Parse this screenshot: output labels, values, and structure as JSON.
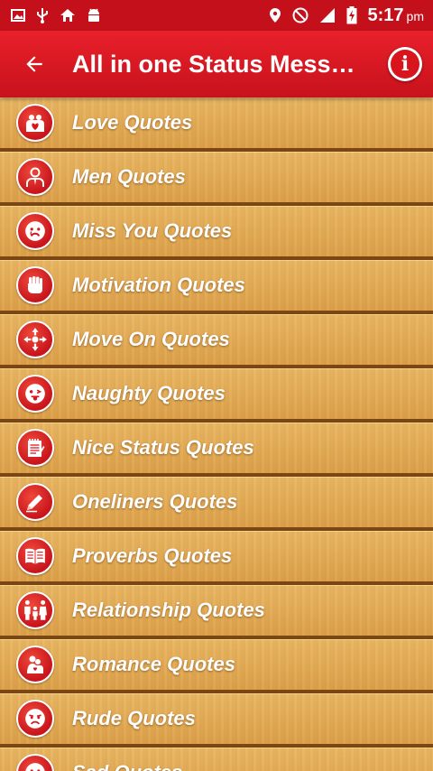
{
  "status_bar": {
    "time": "5:17",
    "ampm": "pm",
    "icons_left": [
      "image-icon",
      "usb-icon",
      "home-icon",
      "android-icon"
    ],
    "icons_right": [
      "location-icon",
      "do-not-disturb-icon",
      "signal-icon",
      "battery-charging-icon"
    ]
  },
  "app_bar": {
    "title": "All in one Status Mess…",
    "back_icon": "arrow-back-icon",
    "info_icon": "info-icon",
    "info_glyph": "i"
  },
  "colors": {
    "primary_red": "#c4101a",
    "wood": "#dca04a",
    "wood_dark": "#7a4614"
  },
  "categories": [
    {
      "label": "Love Quotes",
      "icon": "couple-heart-icon"
    },
    {
      "label": "Men Quotes",
      "icon": "man-icon"
    },
    {
      "label": "Miss You Quotes",
      "icon": "sad-face-icon"
    },
    {
      "label": "Motivation Quotes",
      "icon": "fist-icon"
    },
    {
      "label": "Move On Quotes",
      "icon": "move-arrows-icon"
    },
    {
      "label": "Naughty Quotes",
      "icon": "wink-tongue-icon"
    },
    {
      "label": "Nice Status Quotes",
      "icon": "notepad-icon"
    },
    {
      "label": "Oneliners Quotes",
      "icon": "pencil-icon"
    },
    {
      "label": "Proverbs Quotes",
      "icon": "open-book-icon"
    },
    {
      "label": "Relationship Quotes",
      "icon": "family-icon"
    },
    {
      "label": "Romance Quotes",
      "icon": "romance-couple-icon"
    },
    {
      "label": "Rude Quotes",
      "icon": "annoyed-face-icon"
    },
    {
      "label": "Sad Quotes",
      "icon": "crying-face-icon"
    }
  ]
}
